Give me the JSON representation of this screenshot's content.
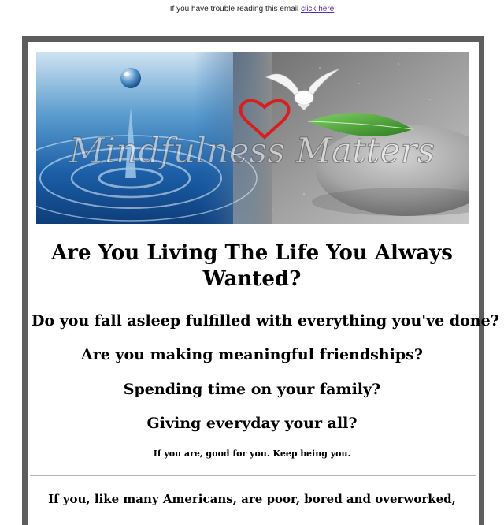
{
  "top": {
    "trouble_text": "If you have trouble reading this email",
    "link_text": "click here"
  },
  "banner": {
    "logo_text": "Mindfulness Matters",
    "colors": {
      "water": "#1b5fa8",
      "stone": "#9a9a9a",
      "leaf": "#3f9a2e",
      "heart": "#d62020"
    }
  },
  "content": {
    "headline": "Are You Living The Life You Always Wanted?",
    "questions": [
      "Do you fall asleep fulfilled with everything you've done?",
      "Are you making meaningful friendships?",
      "Spending time on your family?",
      "Giving everyday your all?"
    ],
    "encouragement": "If you are, good for you. Keep being you.",
    "bottom_line": "If you, like many Americans, are poor, bored and overworked,"
  },
  "colors": {
    "frame": "#5d5d5d",
    "link": "#5a2ca0",
    "divider": "#b5b5b5"
  }
}
